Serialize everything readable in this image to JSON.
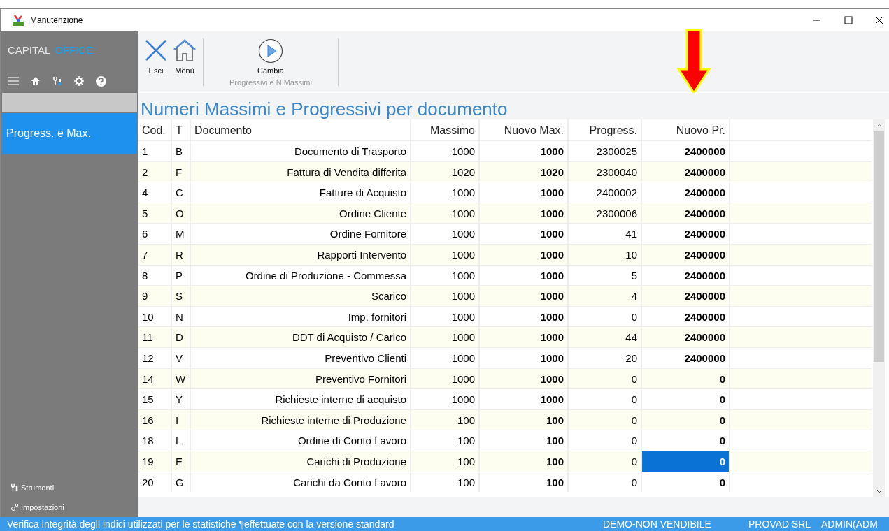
{
  "window": {
    "title": "Manutenzione"
  },
  "sidebar": {
    "brand": [
      "CAPITAL",
      "OFFICE"
    ],
    "items": [
      {
        "label": "Progress.  e Max.",
        "selected": true
      }
    ],
    "footer": [
      "Strumenti",
      "Impostazioni"
    ]
  },
  "toolbar": {
    "buttons": [
      {
        "label": "Esci",
        "kind": "close"
      },
      {
        "label": "Menù",
        "kind": "home"
      }
    ],
    "action": {
      "label": "Cambia",
      "caption": "Progressivi e N.Massimi"
    }
  },
  "heading": "Numeri Massimi e Progressivi per documento",
  "table": {
    "columns": [
      "Cod.",
      "T",
      "Documento",
      "Massimo",
      "Nuovo Max.",
      "Progress.",
      "Nuovo Pr."
    ],
    "rows": [
      {
        "cells": [
          "1",
          "B",
          "Documento di Trasporto",
          "1000",
          "1000",
          "2300025",
          "2400000"
        ],
        "selected": false
      },
      {
        "cells": [
          "2",
          "F",
          "Fattura di Vendita differita",
          "1020",
          "1020",
          "2300040",
          "2400000"
        ],
        "selected": false
      },
      {
        "cells": [
          "4",
          "C",
          "Fatture di Acquisto",
          "1000",
          "1000",
          "2400002",
          "2400000"
        ],
        "selected": false
      },
      {
        "cells": [
          "5",
          "O",
          "Ordine Cliente",
          "1000",
          "1000",
          "2300006",
          "2400000"
        ],
        "selected": false
      },
      {
        "cells": [
          "6",
          "M",
          "Ordine Fornitore",
          "1000",
          "1000",
          "41",
          "2400000"
        ],
        "selected": false
      },
      {
        "cells": [
          "7",
          "R",
          "Rapporti Intervento",
          "1000",
          "1000",
          "10",
          "2400000"
        ],
        "selected": false
      },
      {
        "cells": [
          "8",
          "P",
          "Ordine di Produzione - Commessa",
          "1000",
          "1000",
          "5",
          "2400000"
        ],
        "selected": false
      },
      {
        "cells": [
          "9",
          "S",
          "Scarico",
          "1000",
          "1000",
          "4",
          "2400000"
        ],
        "selected": false
      },
      {
        "cells": [
          "10",
          "N",
          "Imp. fornitori",
          "1000",
          "1000",
          "0",
          "2400000"
        ],
        "selected": false
      },
      {
        "cells": [
          "11",
          "D",
          "DDT di Acquisto / Carico",
          "1000",
          "1000",
          "44",
          "2400000"
        ],
        "selected": false
      },
      {
        "cells": [
          "12",
          "V",
          "Preventivo Clienti",
          "1000",
          "1000",
          "20",
          "2400000"
        ],
        "selected": false
      },
      {
        "cells": [
          "14",
          "W",
          "Preventivo Fornitori",
          "1000",
          "1000",
          "0",
          "0"
        ],
        "selected": false
      },
      {
        "cells": [
          "15",
          "Y",
          "Richieste interne di acquisto",
          "1000",
          "1000",
          "0",
          "0"
        ],
        "selected": false
      },
      {
        "cells": [
          "16",
          "I",
          "Richieste interne di Produzione",
          "100",
          "100",
          "0",
          "0"
        ],
        "selected": false
      },
      {
        "cells": [
          "18",
          "L",
          "Ordine di Conto Lavoro",
          "100",
          "100",
          "0",
          "0"
        ],
        "selected": false
      },
      {
        "cells": [
          "19",
          "E",
          "Carichi di Produzione",
          "100",
          "100",
          "0",
          "0"
        ],
        "selected": true
      },
      {
        "cells": [
          "20",
          "G",
          "Carichi da Conto Lavoro",
          "100",
          "100",
          "0",
          "0"
        ],
        "selected": false
      }
    ]
  },
  "status_bar": [
    "Verifica integrità degli indici utilizzati per le statistiche ¶effettuate con la versione standard",
    "DEMO-NON VENDIBILE",
    "PROVAD SRL",
    "ADMIN(ADM"
  ]
}
